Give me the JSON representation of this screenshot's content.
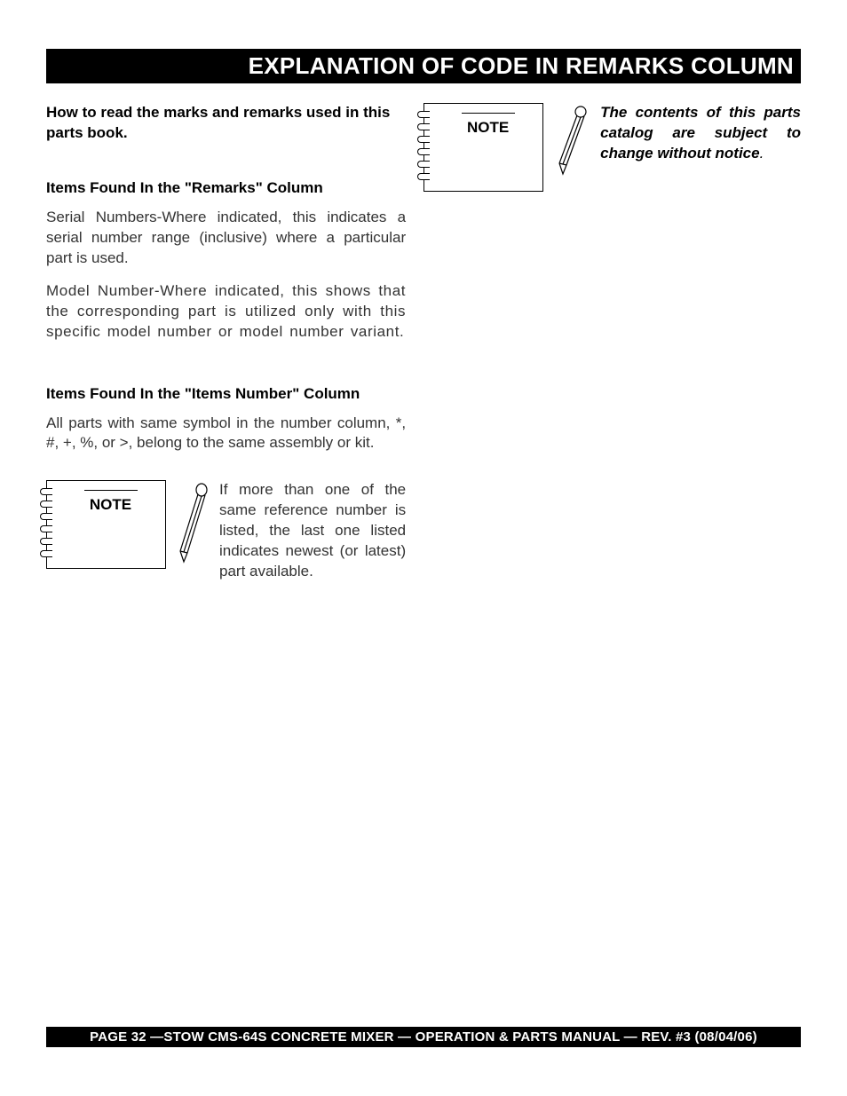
{
  "header": {
    "title": "EXPLANATION OF CODE IN REMARKS COLUMN"
  },
  "left": {
    "intro": "How to read the marks and remarks used in this parts book.",
    "remarks_heading": "Items Found In the \"Remarks\" Column",
    "remarks_serial": "Serial Numbers-Where indicated, this indicates a serial number range (inclusive) where a particular part is used.",
    "remarks_model": "Model Number-Where indicated, this shows that the corresponding part is utilized only with this specific model number or model number variant.",
    "items_heading": "Items Found In the \"Items Number\" Column",
    "items_body": "All parts with same symbol in the number column, *, #, +, %, or >, belong to the same assembly or kit.",
    "note1": {
      "label": "NOTE",
      "text": "If more than one of the same reference number is listed, the last one listed indicates newest (or latest) part available."
    }
  },
  "right": {
    "note2": {
      "label": "NOTE",
      "text_bold": "The contents of this parts catalog are subject to change without notice",
      "text_tail": "."
    }
  },
  "footer": {
    "text": "PAGE 32 —STOW CMS-64S CONCRETE MIXER — OPERATION & PARTS MANUAL — REV. #3 (08/04/06)"
  }
}
